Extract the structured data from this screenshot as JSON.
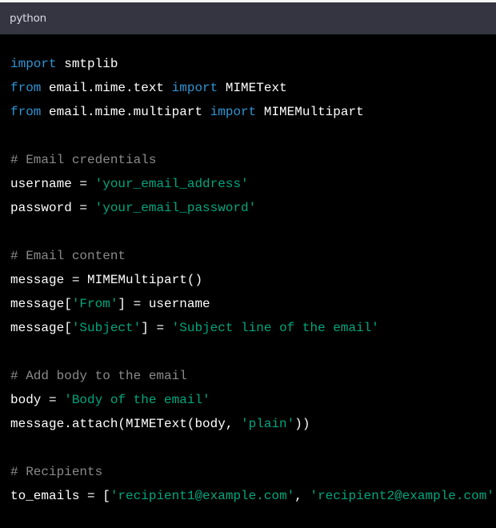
{
  "code_block": {
    "language_label": "python",
    "colors": {
      "keyword": "#2e95d3",
      "string": "#00a67d",
      "comment": "#8a8a8a",
      "text": "#ffffff",
      "header_bg": "#343541",
      "body_bg": "#000000"
    },
    "lines": [
      [
        {
          "t": "kw",
          "v": "import"
        },
        {
          "t": "txt",
          "v": " smtplib"
        }
      ],
      [
        {
          "t": "kw",
          "v": "from"
        },
        {
          "t": "txt",
          "v": " email.mime.text "
        },
        {
          "t": "kw",
          "v": "import"
        },
        {
          "t": "txt",
          "v": " MIMEText"
        }
      ],
      [
        {
          "t": "kw",
          "v": "from"
        },
        {
          "t": "txt",
          "v": " email.mime.multipart "
        },
        {
          "t": "kw",
          "v": "import"
        },
        {
          "t": "txt",
          "v": " MIMEMultipart"
        }
      ],
      [],
      [
        {
          "t": "cmt",
          "v": "# Email credentials"
        }
      ],
      [
        {
          "t": "txt",
          "v": "username = "
        },
        {
          "t": "str",
          "v": "'your_email_address'"
        }
      ],
      [
        {
          "t": "txt",
          "v": "password = "
        },
        {
          "t": "str",
          "v": "'your_email_password'"
        }
      ],
      [],
      [
        {
          "t": "cmt",
          "v": "# Email content"
        }
      ],
      [
        {
          "t": "txt",
          "v": "message = MIMEMultipart()"
        }
      ],
      [
        {
          "t": "txt",
          "v": "message["
        },
        {
          "t": "str",
          "v": "'From'"
        },
        {
          "t": "txt",
          "v": "] = username"
        }
      ],
      [
        {
          "t": "txt",
          "v": "message["
        },
        {
          "t": "str",
          "v": "'Subject'"
        },
        {
          "t": "txt",
          "v": "] = "
        },
        {
          "t": "str",
          "v": "'Subject line of the email'"
        }
      ],
      [],
      [
        {
          "t": "cmt",
          "v": "# Add body to the email"
        }
      ],
      [
        {
          "t": "txt",
          "v": "body = "
        },
        {
          "t": "str",
          "v": "'Body of the email'"
        }
      ],
      [
        {
          "t": "txt",
          "v": "message.attach(MIMEText(body, "
        },
        {
          "t": "str",
          "v": "'plain'"
        },
        {
          "t": "txt",
          "v": "))"
        }
      ],
      [],
      [
        {
          "t": "cmt",
          "v": "# Recipients"
        }
      ],
      [
        {
          "t": "txt",
          "v": "to_emails = ["
        },
        {
          "t": "str",
          "v": "'recipient1@example.com'"
        },
        {
          "t": "txt",
          "v": ", "
        },
        {
          "t": "str",
          "v": "'recipient2@example.com'"
        }
      ]
    ]
  }
}
